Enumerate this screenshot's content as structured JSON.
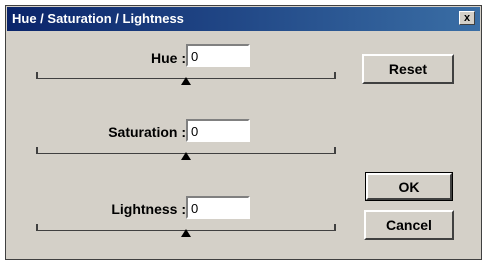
{
  "dialog": {
    "title": "Hue / Saturation / Lightness",
    "close_glyph": "x"
  },
  "sliders": [
    {
      "label": "Hue :",
      "value": "0",
      "level": 0.5
    },
    {
      "label": "Saturation :",
      "value": "0",
      "level": 0.5
    },
    {
      "label": "Lightness :",
      "value": "0",
      "level": 0.5
    }
  ],
  "buttons": {
    "reset": "Reset",
    "ok": "OK",
    "cancel": "Cancel"
  },
  "colors": {
    "titlebar_start": "#0a246a",
    "titlebar_end": "#3a6ea5",
    "face": "#d4d0c8"
  }
}
